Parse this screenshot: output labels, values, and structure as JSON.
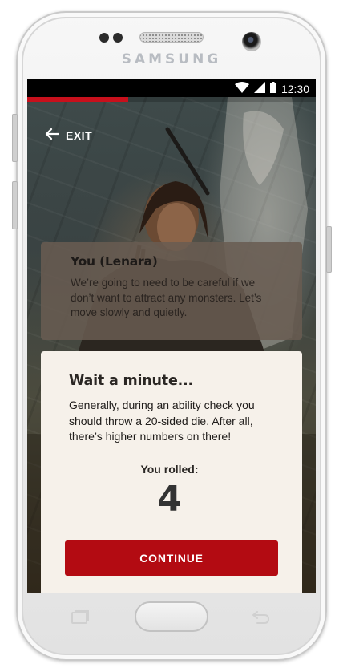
{
  "device": {
    "brand": "SAMSUNG"
  },
  "status_bar": {
    "time": "12:30",
    "icons": [
      "wifi-icon",
      "cellular-signal-icon",
      "battery-icon"
    ]
  },
  "progress": {
    "fraction": 0.35,
    "color": "#c8101c"
  },
  "nav": {
    "exit_label": "EXIT"
  },
  "dialog": {
    "speaker": "You (Lenara)",
    "text": "We’re going to need to be careful if we don’t want to attract any monsters. Let’s move slowly and quietly."
  },
  "modal": {
    "title": "Wait a minute...",
    "body": "Generally, during an ability check you should throw a 20-sided die. After all, there’s higher numbers on there!",
    "rolled_label": "You rolled:",
    "rolled_value": "4",
    "continue_label": "CONTINUE"
  },
  "colors": {
    "accent_red": "#b30b12",
    "modal_bg": "#f6f1ea",
    "dialog_bg": "#695c52"
  }
}
